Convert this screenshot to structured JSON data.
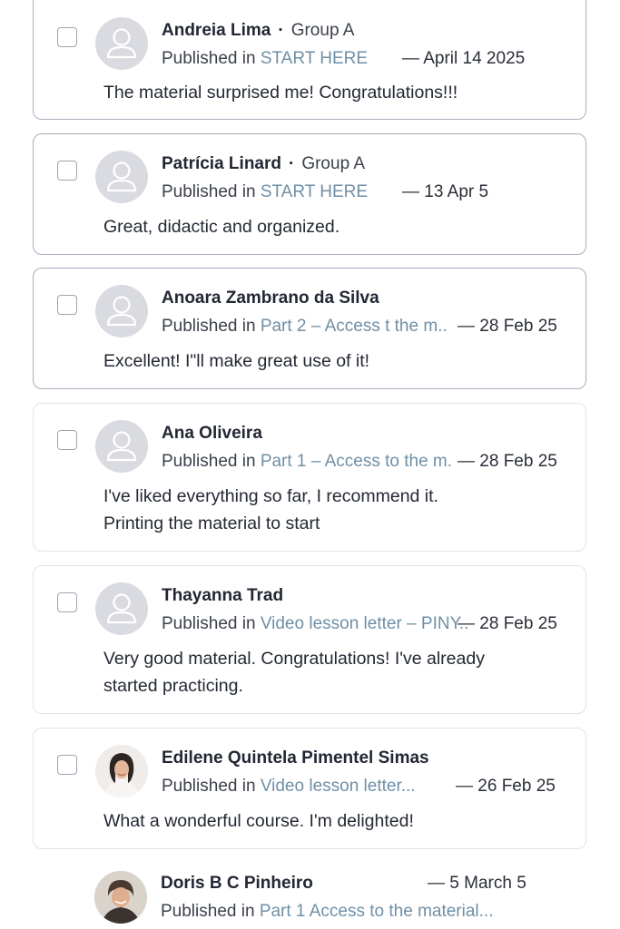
{
  "feed": {
    "items": [
      {
        "name": "Andreia Lima",
        "separator": "·",
        "group": "Group A",
        "published_in": "Published in",
        "link": "START HERE",
        "date": "— April 14 2025",
        "text": "The material surprised me! Congratulations!!!",
        "avatar": "default-user-icon",
        "checked": false
      },
      {
        "name": "Patrícia Linard",
        "separator": "·",
        "group": "Group A",
        "published_in": "Published in",
        "link": "START HERE",
        "date": "— 13 Apr 5",
        "text": "Great, didactic and organized.",
        "avatar": "default-user-icon",
        "checked": false
      },
      {
        "name": "Anoara Zambrano da Silva",
        "published_in": "Published in",
        "link": "Part 2 – Access t the m..",
        "date": "— 28 Feb 25",
        "text": "Excellent! I\"ll make great use of it!",
        "avatar": "default-user-icon",
        "checked": false
      },
      {
        "name": "Ana Oliveira",
        "published_in": "Published in",
        "link": "Part 1 – Access to the m.",
        "date": "— 28 Feb 25",
        "text": "I've liked everything so far, I recommend it. Printing the material to start",
        "avatar": "default-user-icon",
        "checked": false
      },
      {
        "name": "Thayanna Trad",
        "published_in": "Published in",
        "link": "Video lesson letter – PINY..",
        "date": "— 28 Feb 25",
        "text": "Very good material. Congratulations! I've already started practicing.",
        "avatar": "default-user-icon",
        "checked": false
      },
      {
        "name": "Edilene Quintela Pimentel Simas",
        "published_in": "Published in",
        "link": "Video lesson letter...",
        "date": "— 26 Feb 25",
        "text": "What a wonderful course. I'm delighted!",
        "avatar": "user-photo",
        "checked": false
      },
      {
        "name": "Doris B C Pinheiro",
        "published_in": "Published in",
        "link": "Part 1 Access to the material...",
        "date": "— 5 March 5",
        "text": "",
        "avatar": "user-photo",
        "checked": false
      }
    ]
  },
  "colors": {
    "link": "#6f8fa6",
    "border": "#dfe2e8",
    "border_strong": "#a9aebc",
    "avatar_bg": "#d9dbe1"
  }
}
